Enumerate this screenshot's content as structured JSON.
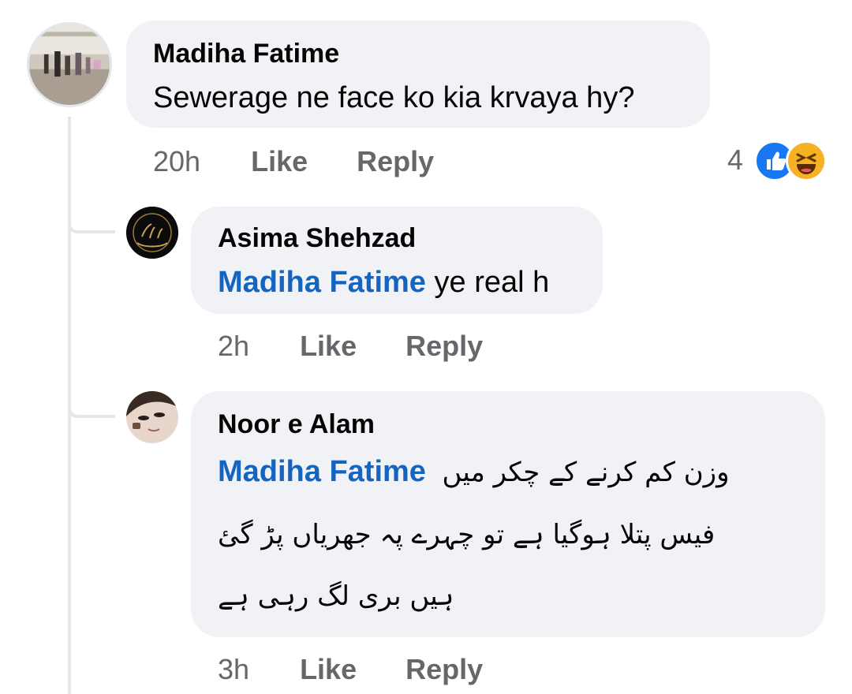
{
  "comments": [
    {
      "author": "Madiha Fatime",
      "text": "Sewerage ne face ko kia krvaya hy?",
      "time": "20h",
      "like_label": "Like",
      "reply_label": "Reply",
      "reactions": {
        "count": "4",
        "icons": [
          "like-icon",
          "haha-icon"
        ]
      }
    }
  ],
  "replies": [
    {
      "author": "Asima Shehzad",
      "mention": "Madiha Fatime",
      "text": "ye real h",
      "time": "2h",
      "like_label": "Like",
      "reply_label": "Reply"
    },
    {
      "author": "Noor e Alam",
      "mention": "Madiha Fatime",
      "text_line1": "وزن کم کرنے کے چکر میں",
      "text_line2": "فیس پتلا ہوگیا ہے تو چہرے پہ جھریاں پڑ گئ",
      "text_line3": "ہیں بری لگ رہی ہے",
      "time": "3h",
      "like_label": "Like",
      "reply_label": "Reply"
    }
  ],
  "colors": {
    "bubble": "#f0f2f5",
    "mention": "#1565c0",
    "meta": "#65676b",
    "like_reaction": "#1877f2",
    "haha_reaction": "#f7b125"
  }
}
